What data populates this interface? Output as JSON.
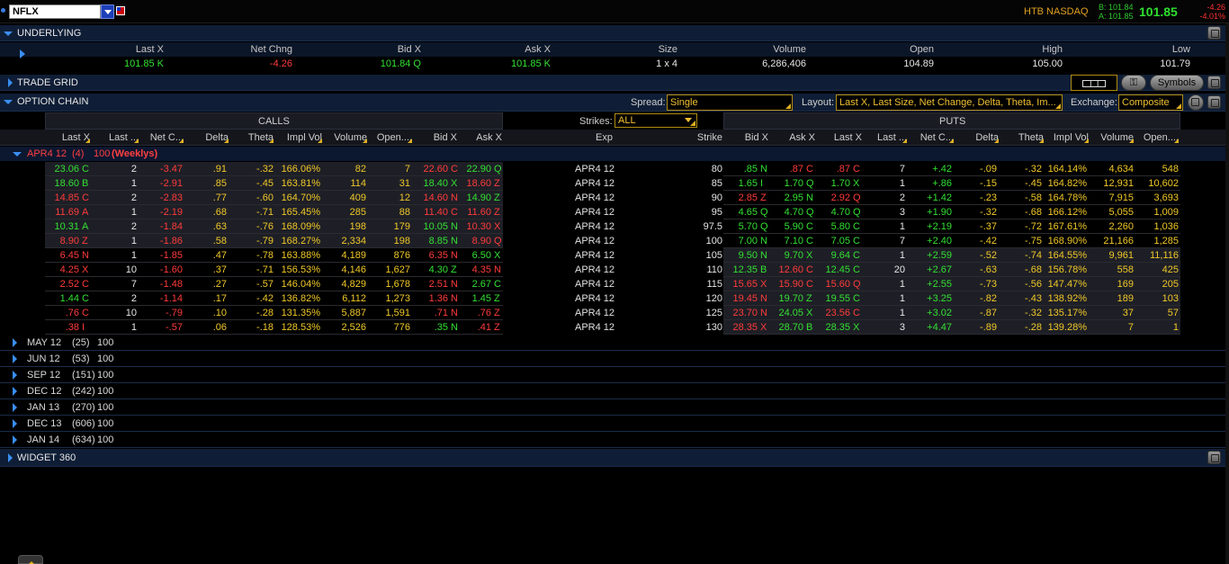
{
  "header": {
    "symbol": "NFLX",
    "exchange_tag": "HTB NASDAQ",
    "bid_line": "B: 101.84",
    "ask_line": "A: 101.85",
    "last_price": "101.85",
    "net_change": "-4.26",
    "pct_change": "-4.01%"
  },
  "underlying": {
    "title": "UNDERLYING",
    "columns": [
      "Last X",
      "Net Chng",
      "Bid X",
      "Ask X",
      "Size",
      "Volume",
      "Open",
      "High",
      "Low"
    ],
    "values": [
      "101.85 K",
      "-4.26",
      "101.84 Q",
      "101.85 K",
      "1 x 4",
      "6,286,406",
      "104.89",
      "105.00",
      "101.79"
    ]
  },
  "trade_grid": {
    "title": "TRADE GRID"
  },
  "option_chain": {
    "title": "OPTION CHAIN",
    "spread_label": "Spread:",
    "spread_value": "Single",
    "layout_label": "Layout:",
    "layout_value": "Last X, Last Size, Net Change, Delta, Theta, Im...",
    "exchange_label": "Exchange:",
    "exchange_value": "Composite",
    "symbols_button": "Symbols",
    "strikes_label": "Strikes:",
    "strikes_value": "ALL",
    "calls_label": "CALLS",
    "puts_label": "PUTS",
    "call_columns": [
      "Last X",
      "Last ...",
      "Net C...",
      "Delta",
      "Theta",
      "Impl Vol",
      "Volume",
      "Open....",
      "Bid X",
      "Ask X"
    ],
    "mid_columns": [
      "Exp",
      "Strike"
    ],
    "put_columns": [
      "Bid X",
      "Ask X",
      "Last X",
      "Last ...",
      "Net C...",
      "Delta",
      "Theta",
      "Impl Vol",
      "Volume",
      "Open...."
    ],
    "expanded_series": {
      "name": "APR4 12",
      "days": "(4)",
      "mult": "100",
      "tag": "(Weeklys)"
    },
    "rows": [
      {
        "cl": "23.06",
        "clx": "C",
        "cs": "2",
        "cn": "-3.47",
        "cd": ".91",
        "ct": "-.32",
        "civ": "166.06%",
        "cv": "82",
        "coi": "7",
        "cb": "22.60",
        "cbx": "C",
        "ca": "22.90",
        "cax": "Q",
        "exp": "APR4 12",
        "strike": "80",
        "pb": ".85",
        "pbx": "N",
        "pa": ".87",
        "pax": "C",
        "pl": ".87",
        "plx": "C",
        "ps": "7",
        "pn": "+.42",
        "pd": "-.09",
        "pt": "-.32",
        "piv": "164.14%",
        "pv": "4,634",
        "poi": "548"
      },
      {
        "cl": "18.60",
        "clx": "B",
        "cs": "1",
        "cn": "-2.91",
        "cd": ".85",
        "ct": "-.45",
        "civ": "163.81%",
        "cv": "114",
        "coi": "31",
        "cb": "18.40",
        "cbx": "X",
        "ca": "18.60",
        "cax": "Z",
        "exp": "APR4 12",
        "strike": "85",
        "pb": "1.65",
        "pbx": "I",
        "pa": "1.70",
        "pax": "Q",
        "pl": "1.70",
        "plx": "X",
        "ps": "1",
        "pn": "+.86",
        "pd": "-.15",
        "pt": "-.45",
        "piv": "164.82%",
        "pv": "12,931",
        "poi": "10,602"
      },
      {
        "cl": "14.85",
        "clx": "C",
        "cs": "2",
        "cn": "-2.83",
        "cd": ".77",
        "ct": "-.60",
        "civ": "164.70%",
        "cv": "409",
        "coi": "12",
        "cb": "14.60",
        "cbx": "N",
        "ca": "14.90",
        "cax": "Z",
        "exp": "APR4 12",
        "strike": "90",
        "pb": "2.85",
        "pbx": "Z",
        "pa": "2.95",
        "pax": "N",
        "pl": "2.92",
        "plx": "Q",
        "ps": "2",
        "pn": "+1.42",
        "pd": "-.23",
        "pt": "-.58",
        "piv": "164.78%",
        "pv": "7,915",
        "poi": "3,693"
      },
      {
        "cl": "11.69",
        "clx": "A",
        "cs": "1",
        "cn": "-2.19",
        "cd": ".68",
        "ct": "-.71",
        "civ": "165.45%",
        "cv": "285",
        "coi": "88",
        "cb": "11.40",
        "cbx": "C",
        "ca": "11.60",
        "cax": "Z",
        "exp": "APR4 12",
        "strike": "95",
        "pb": "4.65",
        "pbx": "Q",
        "pa": "4.70",
        "pax": "Q",
        "pl": "4.70",
        "plx": "Q",
        "ps": "3",
        "pn": "+1.90",
        "pd": "-.32",
        "pt": "-.68",
        "piv": "166.12%",
        "pv": "5,055",
        "poi": "1,009"
      },
      {
        "cl": "10.31",
        "clx": "A",
        "cs": "2",
        "cn": "-1.84",
        "cd": ".63",
        "ct": "-.76",
        "civ": "168.09%",
        "cv": "198",
        "coi": "179",
        "cb": "10.05",
        "cbx": "N",
        "ca": "10.30",
        "cax": "X",
        "exp": "APR4 12",
        "strike": "97.5",
        "pb": "5.70",
        "pbx": "Q",
        "pa": "5.90",
        "pax": "C",
        "pl": "5.80",
        "plx": "C",
        "ps": "1",
        "pn": "+2.19",
        "pd": "-.37",
        "pt": "-.72",
        "piv": "167.61%",
        "pv": "2,260",
        "poi": "1,036"
      },
      {
        "cl": "8.90",
        "clx": "Z",
        "cs": "1",
        "cn": "-1.86",
        "cd": ".58",
        "ct": "-.79",
        "civ": "168.27%",
        "cv": "2,334",
        "coi": "198",
        "cb": "8.85",
        "cbx": "N",
        "ca": "8.90",
        "cax": "Q",
        "exp": "APR4 12",
        "strike": "100",
        "pb": "7.00",
        "pbx": "N",
        "pa": "7.10",
        "pax": "C",
        "pl": "7.05",
        "plx": "C",
        "ps": "7",
        "pn": "+2.40",
        "pd": "-.42",
        "pt": "-.75",
        "piv": "168.90%",
        "pv": "21,166",
        "poi": "1,285"
      },
      {
        "cl": "6.45",
        "clx": "N",
        "cs": "1",
        "cn": "-1.85",
        "cd": ".47",
        "ct": "-.78",
        "civ": "163.88%",
        "cv": "4,189",
        "coi": "876",
        "cb": "6.35",
        "cbx": "N",
        "ca": "6.50",
        "cax": "X",
        "exp": "APR4 12",
        "strike": "105",
        "pb": "9.50",
        "pbx": "N",
        "pa": "9.70",
        "pax": "X",
        "pl": "9.64",
        "plx": "C",
        "ps": "1",
        "pn": "+2.59",
        "pd": "-.52",
        "pt": "-.74",
        "piv": "164.55%",
        "pv": "9,961",
        "poi": "11,116"
      },
      {
        "cl": "4.25",
        "clx": "X",
        "cs": "10",
        "cn": "-1.60",
        "cd": ".37",
        "ct": "-.71",
        "civ": "156.53%",
        "cv": "4,146",
        "coi": "1,627",
        "cb": "4.30",
        "cbx": "Z",
        "ca": "4.35",
        "cax": "N",
        "exp": "APR4 12",
        "strike": "110",
        "pb": "12.35",
        "pbx": "B",
        "pa": "12.60",
        "pax": "C",
        "pl": "12.45",
        "plx": "C",
        "ps": "20",
        "pn": "+2.67",
        "pd": "-.63",
        "pt": "-.68",
        "piv": "156.78%",
        "pv": "558",
        "poi": "425"
      },
      {
        "cl": "2.52",
        "clx": "C",
        "cs": "7",
        "cn": "-1.48",
        "cd": ".27",
        "ct": "-.57",
        "civ": "146.04%",
        "cv": "4,829",
        "coi": "1,678",
        "cb": "2.51",
        "cbx": "N",
        "ca": "2.67",
        "cax": "C",
        "exp": "APR4 12",
        "strike": "115",
        "pb": "15.65",
        "pbx": "X",
        "pa": "15.90",
        "pax": "C",
        "pl": "15.60",
        "plx": "Q",
        "ps": "1",
        "pn": "+2.55",
        "pd": "-.73",
        "pt": "-.56",
        "piv": "147.47%",
        "pv": "169",
        "poi": "205"
      },
      {
        "cl": "1.44",
        "clx": "C",
        "cs": "2",
        "cn": "-1.14",
        "cd": ".17",
        "ct": "-.42",
        "civ": "136.82%",
        "cv": "6,112",
        "coi": "1,273",
        "cb": "1.36",
        "cbx": "N",
        "ca": "1.45",
        "cax": "Z",
        "exp": "APR4 12",
        "strike": "120",
        "pb": "19.45",
        "pbx": "N",
        "pa": "19.70",
        "pax": "Z",
        "pl": "19.55",
        "plx": "C",
        "ps": "1",
        "pn": "+3.25",
        "pd": "-.82",
        "pt": "-.43",
        "piv": "138.92%",
        "pv": "189",
        "poi": "103"
      },
      {
        "cl": ".76",
        "clx": "C",
        "cs": "10",
        "cn": "-.79",
        "cd": ".10",
        "ct": "-.28",
        "civ": "131.35%",
        "cv": "5,887",
        "coi": "1,591",
        "cb": ".71",
        "cbx": "N",
        "ca": ".76",
        "cax": "Z",
        "exp": "APR4 12",
        "strike": "125",
        "pb": "23.70",
        "pbx": "N",
        "pa": "24.05",
        "pax": "X",
        "pl": "23.56",
        "plx": "C",
        "ps": "1",
        "pn": "+3.02",
        "pd": "-.87",
        "pt": "-.32",
        "piv": "135.17%",
        "pv": "37",
        "poi": "57"
      },
      {
        "cl": ".38",
        "clx": "I",
        "cs": "1",
        "cn": "-.57",
        "cd": ".06",
        "ct": "-.18",
        "civ": "128.53%",
        "cv": "2,526",
        "coi": "776",
        "cb": ".35",
        "cbx": "N",
        "ca": ".41",
        "cax": "Z",
        "exp": "APR4 12",
        "strike": "130",
        "pb": "28.35",
        "pbx": "X",
        "pa": "28.70",
        "pax": "B",
        "pl": "28.35",
        "plx": "X",
        "ps": "3",
        "pn": "+4.47",
        "pd": "-.89",
        "pt": "-.28",
        "piv": "139.28%",
        "pv": "7",
        "poi": "1"
      }
    ],
    "row_colors": {
      "cl": [
        "g",
        "g",
        "r",
        "r",
        "g",
        "r",
        "r",
        "r",
        "r",
        "g",
        "r",
        "r"
      ],
      "cb": [
        "r",
        "g",
        "r",
        "r",
        "g",
        "g",
        "r",
        "g",
        "r",
        "r",
        "r",
        "g"
      ],
      "ca": [
        "g",
        "r",
        "g",
        "r",
        "r",
        "r",
        "g",
        "r",
        "g",
        "g",
        "r",
        "r"
      ],
      "pb": [
        "g",
        "g",
        "r",
        "g",
        "g",
        "g",
        "g",
        "g",
        "r",
        "r",
        "r",
        "r"
      ],
      "pa": [
        "r",
        "g",
        "g",
        "g",
        "g",
        "g",
        "g",
        "r",
        "r",
        "g",
        "g",
        "g"
      ],
      "pl": [
        "r",
        "g",
        "r",
        "g",
        "g",
        "g",
        "g",
        "g",
        "r",
        "g",
        "r",
        "g"
      ]
    },
    "collapsed_series": [
      {
        "name": "MAY 12",
        "days": "(25)",
        "mult": "100"
      },
      {
        "name": "JUN 12",
        "days": "(53)",
        "mult": "100"
      },
      {
        "name": "SEP 12",
        "days": "(151)",
        "mult": "100"
      },
      {
        "name": "DEC 12",
        "days": "(242)",
        "mult": "100"
      },
      {
        "name": "JAN 13",
        "days": "(270)",
        "mult": "100"
      },
      {
        "name": "DEC 13",
        "days": "(606)",
        "mult": "100"
      },
      {
        "name": "JAN 14",
        "days": "(634)",
        "mult": "100"
      }
    ]
  },
  "widget": {
    "title": "WIDGET 360"
  },
  "colors": {
    "green": "#33e033",
    "red": "#ff3b3b",
    "yellow": "#f0c828",
    "accent": "#3a8ef0",
    "bar": "#0f1e36"
  }
}
